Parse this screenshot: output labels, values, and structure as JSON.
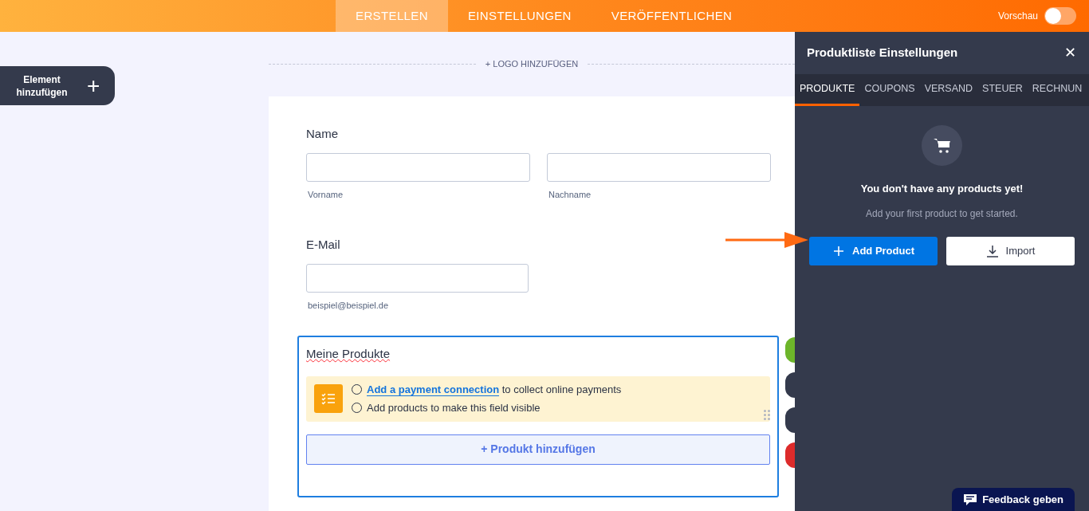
{
  "topbar": {
    "tabs": [
      {
        "label": "ERSTELLEN",
        "selected": true
      },
      {
        "label": "EINSTELLUNGEN",
        "selected": false
      },
      {
        "label": "VERÖFFENTLICHEN",
        "selected": false
      }
    ],
    "preview": {
      "label": "Vorschau",
      "on": false
    }
  },
  "add_element": {
    "label": "Element hinzufügen",
    "icon": "+"
  },
  "logo": "+ LOGO HINZUFÜGEN",
  "form": {
    "name": {
      "label": "Name",
      "fields": [
        {
          "sublabel": "Vorname"
        },
        {
          "sublabel": "Nachname"
        }
      ]
    },
    "email": {
      "label": "E-Mail",
      "sublabel": "beispiel@beispiel.de"
    },
    "products": {
      "label": "Meine Produkte",
      "checklist": [
        {
          "link": "Add a payment connection",
          "text": "to collect online payments",
          "checked": false
        },
        {
          "text": "Add products to make this field visible",
          "checked": false
        }
      ],
      "add_button": "+ Produkt hinzufügen"
    }
  },
  "panel": {
    "title": "Produktliste Einstellungen",
    "close": "✕",
    "tabs": [
      {
        "label": "PRODUKTE",
        "selected": true
      },
      {
        "label": "COUPONS",
        "selected": false
      },
      {
        "label": "VERSAND",
        "selected": false
      },
      {
        "label": "STEUER",
        "selected": false
      },
      {
        "label": "RECHNUN",
        "selected": false
      }
    ],
    "empty_title": "You don't have any products yet!",
    "empty_text": "Add your first product to get started.",
    "buttons": [
      {
        "kind": "primary",
        "label": "Add Product"
      },
      {
        "kind": "secondary",
        "label": "Import"
      }
    ]
  },
  "feedback": "Feedback geben"
}
